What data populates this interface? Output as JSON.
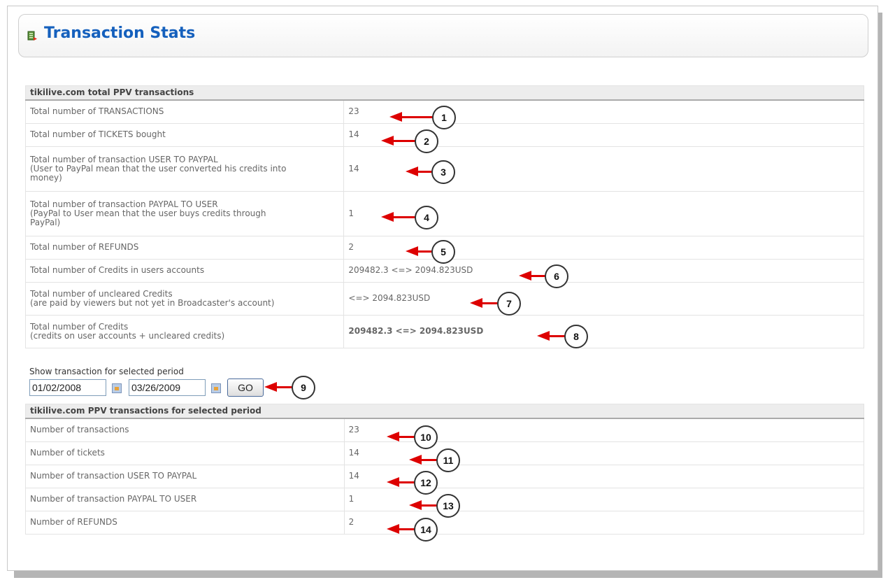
{
  "header": {
    "title": "Transaction Stats",
    "icon": "stats-icon"
  },
  "total_section": {
    "title": "tikilive.com total PPV transactions",
    "rows": [
      {
        "label_lines": [
          "Total number of TRANSACTIONS"
        ],
        "value": "23"
      },
      {
        "label_lines": [
          "Total number of TICKETS bought"
        ],
        "value": "14"
      },
      {
        "label_lines": [
          "Total number of transaction USER TO PAYPAL",
          "(User to PayPal mean that the user converted his credits into",
          "money)"
        ],
        "value": "14"
      },
      {
        "label_lines": [
          "Total number of transaction PAYPAL TO USER",
          "(PayPal to User mean that the user buys credits through",
          "PayPal)"
        ],
        "value": "1"
      },
      {
        "label_lines": [
          "Total number of REFUNDS"
        ],
        "value": "2"
      },
      {
        "label_lines": [
          "Total number of Credits in users accounts"
        ],
        "value": "209482.3 <=> 2094.823USD"
      },
      {
        "label_lines": [
          "Total number of uncleared Credits",
          "(are paid by viewers but not yet in Broadcaster's account)"
        ],
        "value": "<=> 2094.823USD"
      },
      {
        "label_lines": [
          "Total number of Credits",
          "(credits on user accounts + uncleared credits)"
        ],
        "value": "209482.3 <=> 2094.823USD"
      }
    ]
  },
  "period": {
    "label": "Show transaction for selected period",
    "from": "01/02/2008",
    "to": "03/26/2009",
    "go_label": "GO"
  },
  "period_section": {
    "title": "tikilive.com PPV transactions for selected period",
    "rows": [
      {
        "label": "Number of transactions",
        "value": "23"
      },
      {
        "label": "Number of tickets",
        "value": "14"
      },
      {
        "label": "Number of transaction USER TO PAYPAL",
        "value": "14"
      },
      {
        "label": "Number of transaction PAYPAL TO USER",
        "value": "1"
      },
      {
        "label": "Number of REFUNDS",
        "value": "2"
      }
    ]
  },
  "callouts": [
    "1",
    "2",
    "3",
    "4",
    "5",
    "6",
    "7",
    "8",
    "9",
    "10",
    "11",
    "12",
    "13",
    "14"
  ],
  "colors": {
    "title": "#1560bd",
    "arrow": "#dd0000"
  }
}
